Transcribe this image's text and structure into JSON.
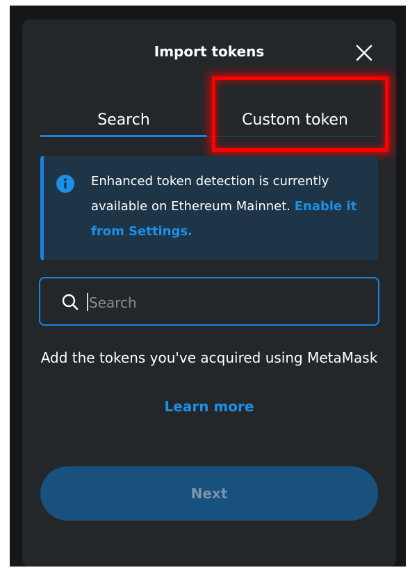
{
  "modal": {
    "title": "Import tokens",
    "close_icon": "close-icon"
  },
  "tabs": [
    {
      "label": "Search",
      "active": true
    },
    {
      "label": "Custom token",
      "active": false,
      "highlighted": true
    }
  ],
  "info_banner": {
    "icon": "info-icon",
    "text": "Enhanced token detection is currently available on Ethereum Mainnet.",
    "link_label": "Enable it from Settings."
  },
  "search": {
    "icon": "search-icon",
    "placeholder": "Search",
    "value": ""
  },
  "help": {
    "text": "Add the tokens you've acquired using MetaMask",
    "link_label": "Learn more"
  },
  "footer": {
    "next_label": "Next",
    "next_disabled": true
  },
  "colors": {
    "background": "#24272a",
    "accent": "#1a82e0",
    "link": "#1d8fe6",
    "banner": "#1e3547",
    "highlight": "#ff0000"
  }
}
